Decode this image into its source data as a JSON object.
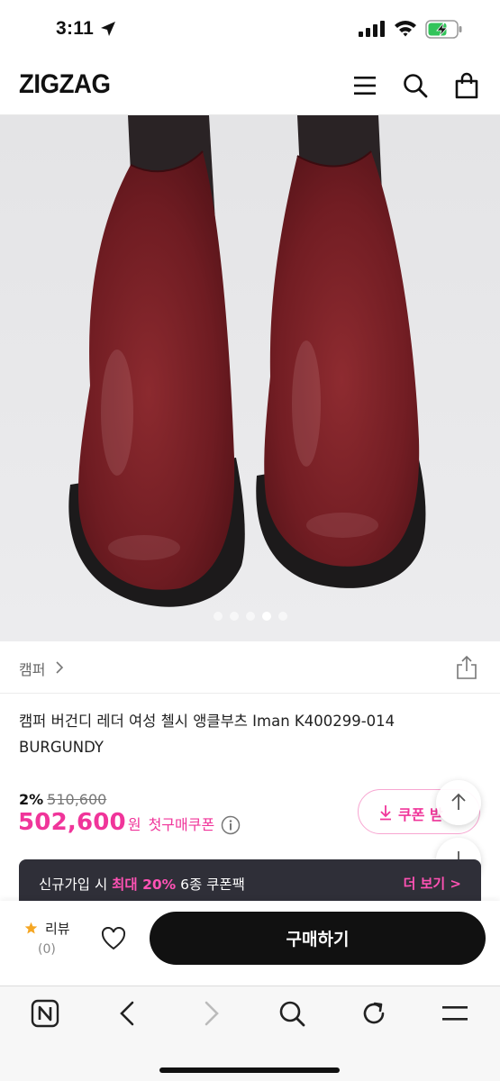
{
  "status_bar": {
    "time": "3:11"
  },
  "header": {
    "logo": "ZIGZAG",
    "icons": [
      "menu-icon",
      "search-icon",
      "shopping-bag-icon"
    ]
  },
  "gallery": {
    "image_count": 5,
    "active_index": 3
  },
  "brand": {
    "name": "캠퍼"
  },
  "product": {
    "title": "캠퍼 버건디 레더 여성 첼시 앵클부츠 Iman K400299-014 BURGUNDY"
  },
  "pricing": {
    "discount_rate": "2%",
    "original_price": "510,600",
    "sale_price": "502,600",
    "currency": "원",
    "coupon_label": "첫구매쿠폰",
    "coupon_button_label": "쿠폰 받"
  },
  "promo": {
    "text_before": "신규가입 시 ",
    "highlight": "최대 20%",
    "text_after": " 6종 쿠폰팩",
    "more_label": "더 보기 >"
  },
  "action_bar": {
    "review_label": "리뷰",
    "review_count": "(0)",
    "buy_label": "구매하기"
  },
  "colors": {
    "accent_pink": "#f0359a",
    "banner_bg": "#2f2f38",
    "buy_button_bg": "#111111"
  }
}
